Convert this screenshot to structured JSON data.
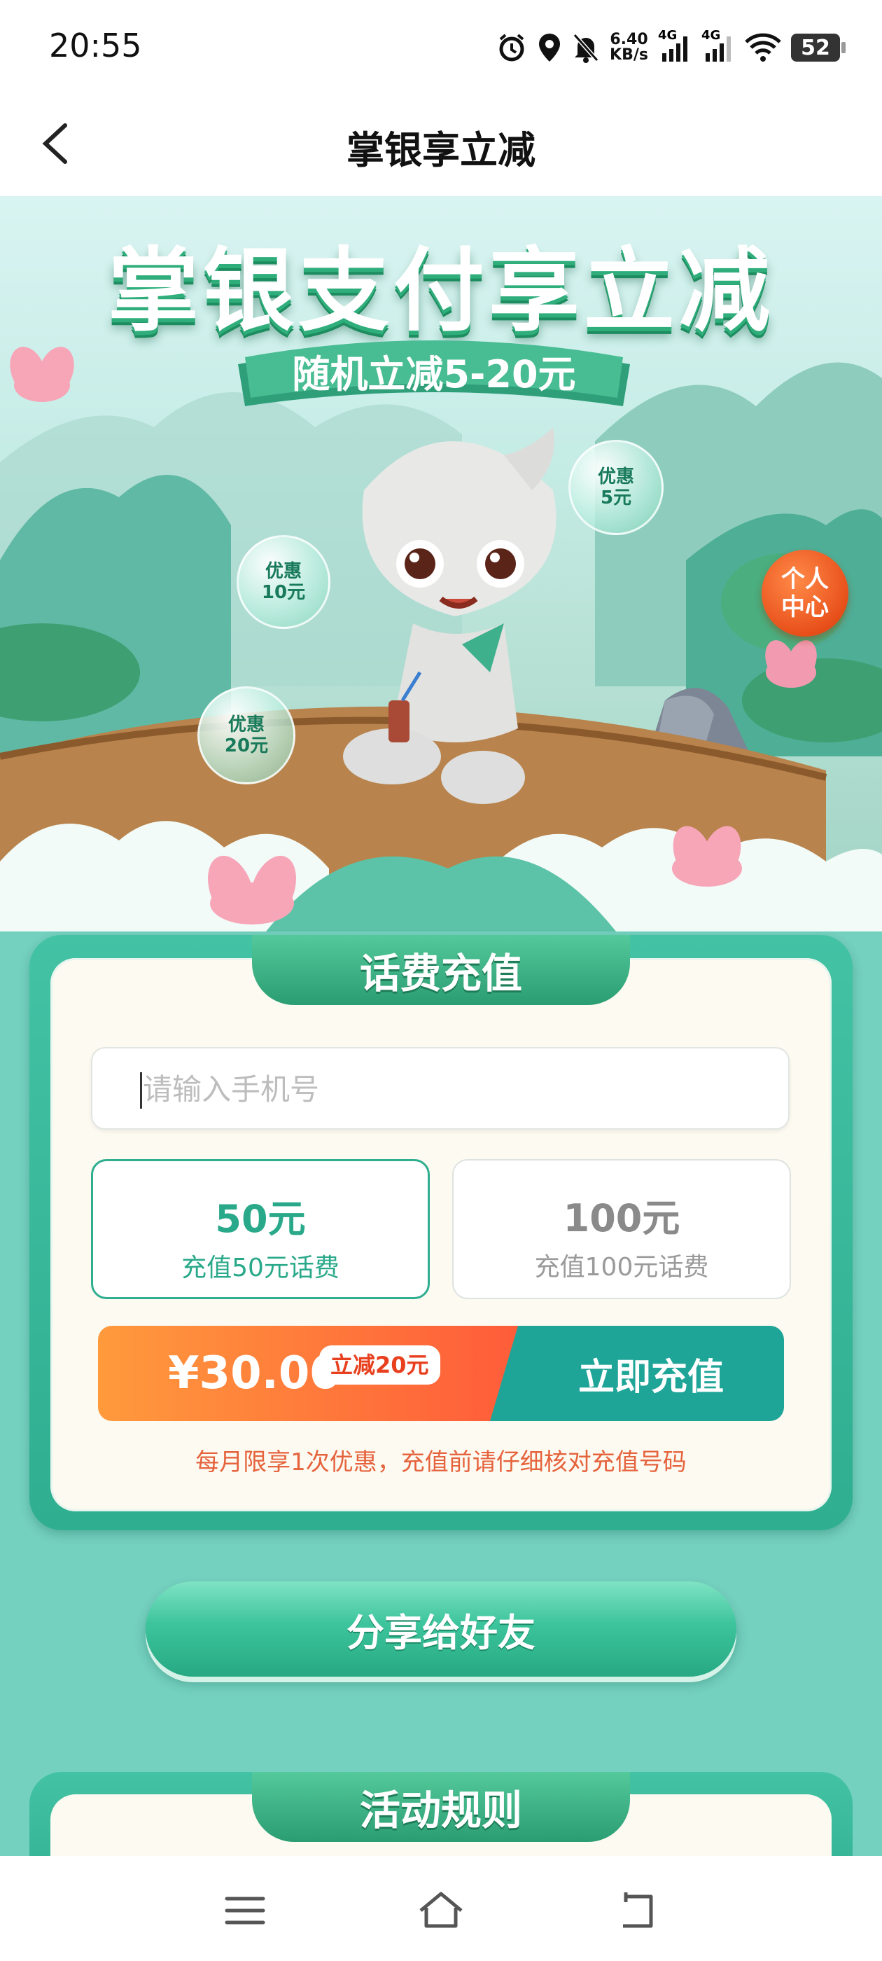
{
  "status_bar": {
    "time": "20:55",
    "net_speed_value": "6.40",
    "net_speed_unit": "KB/s",
    "signal_1": "4G",
    "signal_2": "4G",
    "battery": "52",
    "icons": [
      "alarm-icon",
      "location-icon",
      "mute-icon",
      "signal-icon",
      "wifi-icon",
      "battery-icon"
    ]
  },
  "nav": {
    "title": "掌银享立减",
    "back_icon": "chevron-left-icon"
  },
  "hero": {
    "title": "掌银支付享立减",
    "ribbon": "随机立减5-20元",
    "bubbles": [
      {
        "line1": "优惠",
        "line2": "5元"
      },
      {
        "line1": "优惠",
        "line2": "10元"
      },
      {
        "line1": "优惠",
        "line2": "20元"
      }
    ],
    "personal_center": {
      "line1": "个人",
      "line2": "中心"
    }
  },
  "recharge": {
    "title": "话费充值",
    "phone_placeholder": "请输入手机号",
    "options": [
      {
        "amount": "50元",
        "desc": "充值50元话费",
        "selected": true
      },
      {
        "amount": "100元",
        "desc": "充值100元话费",
        "selected": false
      }
    ],
    "price": "¥30.00",
    "discount_badge": "立减20元",
    "submit_label": "立即充值",
    "notice": "每月限享1次优惠，充值前请仔细核对充值号码"
  },
  "share_label": "分享给好友",
  "rules_title": "活动规则",
  "bottom_nav": {
    "icons": [
      "menu-icon",
      "home-icon",
      "back-icon"
    ]
  },
  "colors": {
    "accent": "#2fae90",
    "orange": "#ff5c3a",
    "teal_button": "#1fa598",
    "page_bg": "#74d0bf"
  }
}
